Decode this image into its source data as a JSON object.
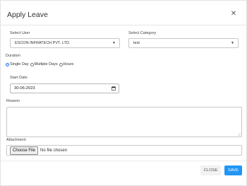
{
  "dialog": {
    "title": "Apply Leave",
    "close_icon": "close-icon"
  },
  "form": {
    "select_user": {
      "label": "Select User",
      "value": "ESCON INFRATECH PVT. LTD."
    },
    "select_category": {
      "label": "Select Category",
      "value": "test"
    },
    "duration": {
      "label": "Duration",
      "options": [
        "Single Day",
        "Multiple Days",
        "Hours"
      ],
      "selected": "Single Day"
    },
    "start_date": {
      "label": "Start Date",
      "value": "30-06-2023"
    },
    "reason": {
      "label": "Reason",
      "value": ""
    },
    "attachment": {
      "label": "Attachment",
      "button": "Choose File",
      "status": "No file chosen"
    }
  },
  "footer": {
    "close_label": "CLOSE",
    "save_label": "SAVE"
  },
  "colors": {
    "primary": "#2196f3"
  }
}
